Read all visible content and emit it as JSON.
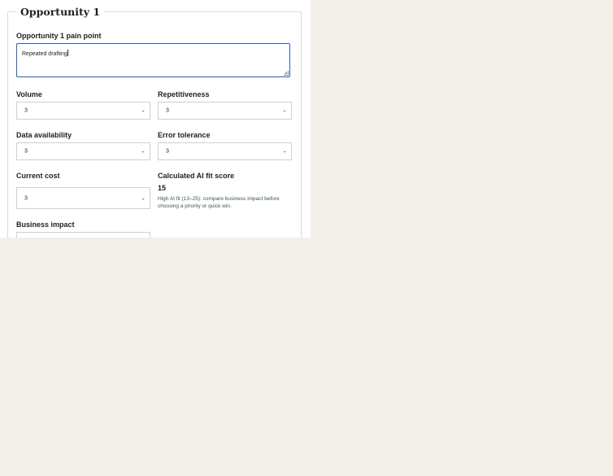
{
  "opportunity": {
    "legend": "Opportunity 1",
    "pain_point_label": "Opportunity 1 pain point",
    "pain_point_value": "Repeated drafting"
  },
  "fields": {
    "volume": {
      "label": "Volume",
      "value": "3"
    },
    "repetitiveness": {
      "label": "Repetitiveness",
      "value": "3"
    },
    "data_availability": {
      "label": "Data availability",
      "value": "3"
    },
    "error_tolerance": {
      "label": "Error tolerance",
      "value": "3"
    },
    "current_cost": {
      "label": "Current cost",
      "value": "3"
    },
    "business_impact": {
      "label": "Business impact",
      "value": ""
    }
  },
  "score": {
    "label": "Calculated AI fit score",
    "value": "15",
    "hint": "High AI fit (13–25): compare business impact before choosing a priority or quick win."
  },
  "icons": {
    "chevron": "chevron-down-icon"
  },
  "colors": {
    "background": "#f2efe8",
    "panel": "#ffffff",
    "focus_border": "#2f5fb3",
    "hint_text": "#3b5a4a"
  }
}
